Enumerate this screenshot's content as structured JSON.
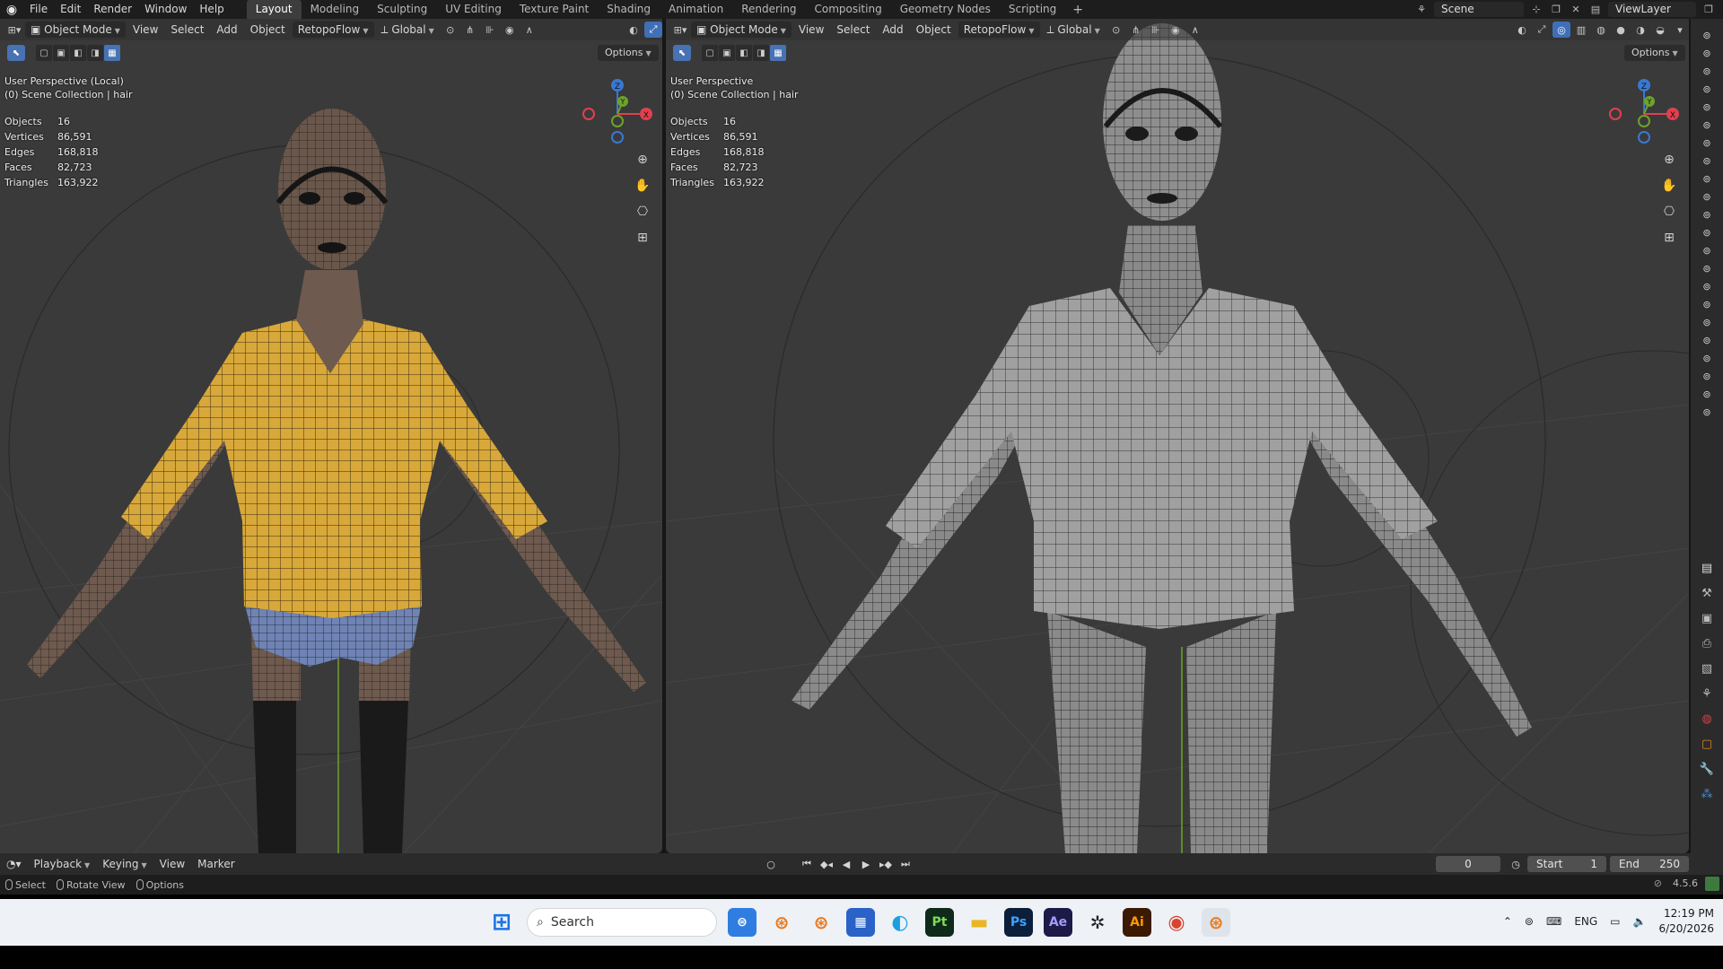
{
  "menubar": {
    "items": [
      "File",
      "Edit",
      "Render",
      "Window",
      "Help"
    ],
    "workspaces": [
      "Layout",
      "Modeling",
      "Sculpting",
      "UV Editing",
      "Texture Paint",
      "Shading",
      "Animation",
      "Rendering",
      "Compositing",
      "Geometry Nodes",
      "Scripting"
    ],
    "active_workspace": "Layout",
    "scene_label": "Scene",
    "view_layer_label": "ViewLayer"
  },
  "viewport_header": {
    "mode": "Object Mode",
    "view": "View",
    "select": "Select",
    "add": "Add",
    "object": "Object",
    "addon": "RetopoFlow",
    "transform": "Global",
    "options": "Options"
  },
  "left_viewport": {
    "perspective": "User Perspective (Local)",
    "collection": "(0) Scene Collection | hair",
    "stats": [
      {
        "label": "Objects",
        "value": "16"
      },
      {
        "label": "Vertices",
        "value": "86,591"
      },
      {
        "label": "Edges",
        "value": "168,818"
      },
      {
        "label": "Faces",
        "value": "82,723"
      },
      {
        "label": "Triangles",
        "value": "163,922"
      }
    ]
  },
  "right_viewport": {
    "perspective": "User Perspective",
    "collection": "(0) Scene Collection | hair",
    "stats": [
      {
        "label": "Objects",
        "value": "16"
      },
      {
        "label": "Vertices",
        "value": "86,591"
      },
      {
        "label": "Edges",
        "value": "168,818"
      },
      {
        "label": "Faces",
        "value": "82,723"
      },
      {
        "label": "Triangles",
        "value": "163,922"
      }
    ]
  },
  "gizmo": {
    "x": "X",
    "y": "Y",
    "z": "Z"
  },
  "colors": {
    "x_axis": "#e0404f",
    "y_axis": "#6ea22a",
    "z_axis": "#3a78d1",
    "accent": "#4772b3",
    "shirt": "#d8a83a"
  },
  "timeline": {
    "playback": "Playback",
    "keying": "Keying",
    "view": "View",
    "marker": "Marker",
    "current_frame": "0",
    "start_label": "Start",
    "start_value": "1",
    "end_label": "End",
    "end_value": "250"
  },
  "statusbar": {
    "select": "Select",
    "rotate_view": "Rotate View",
    "options": "Options",
    "version": "4.5.6"
  },
  "taskbar": {
    "search_placeholder": "Search",
    "language": "ENG",
    "time": "12:19 PM",
    "date": "6/20/2026",
    "apps": [
      "Pt",
      "Ps",
      "Ae",
      "Ai"
    ]
  }
}
